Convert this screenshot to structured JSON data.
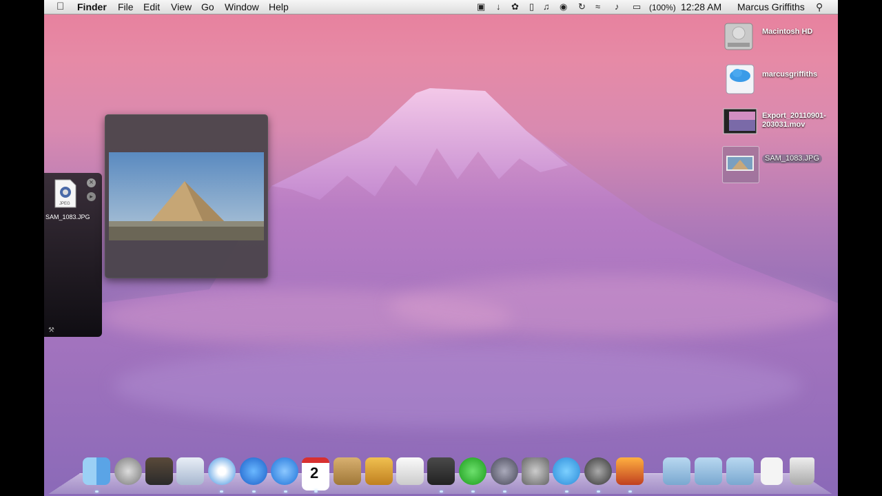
{
  "menubar": {
    "apple_icon": "apple-icon",
    "app_name": "Finder",
    "menus": [
      "File",
      "Edit",
      "View",
      "Go",
      "Window",
      "Help"
    ],
    "battery": "(100%)",
    "clock": "12:28 AM",
    "user": "Marcus Griffiths"
  },
  "desktop_icons": [
    {
      "label": "Macintosh HD",
      "icon": "hard-drive-icon"
    },
    {
      "label": "marcusgriffiths",
      "icon": "cloud-drive-icon"
    },
    {
      "label": "Export_20110901-203031.mov",
      "icon": "movie-file-icon"
    },
    {
      "label": "SAM_1083.JPG",
      "icon": "jpeg-file-icon"
    }
  ],
  "stack": {
    "file_label": "SAM_1083.JPG",
    "file_badge": "JPEG"
  },
  "dock": {
    "calendar_date": "2",
    "items": [
      "finder",
      "launchpad",
      "dashboard",
      "mail",
      "safari",
      "itunes",
      "app-store",
      "ical",
      "address-book",
      "iphoto",
      "textedit",
      "steam",
      "utorrent",
      "xcode",
      "system-preferences",
      "twitter",
      "front-row",
      "image-capture",
      "applications-folder",
      "documents-folder",
      "downloads-folder",
      "jpeg-file",
      "trash"
    ]
  },
  "colors": {
    "sky_top": "#e87f9c",
    "sky_bottom": "#7f64b3",
    "menubar": "#e6e6e6"
  }
}
